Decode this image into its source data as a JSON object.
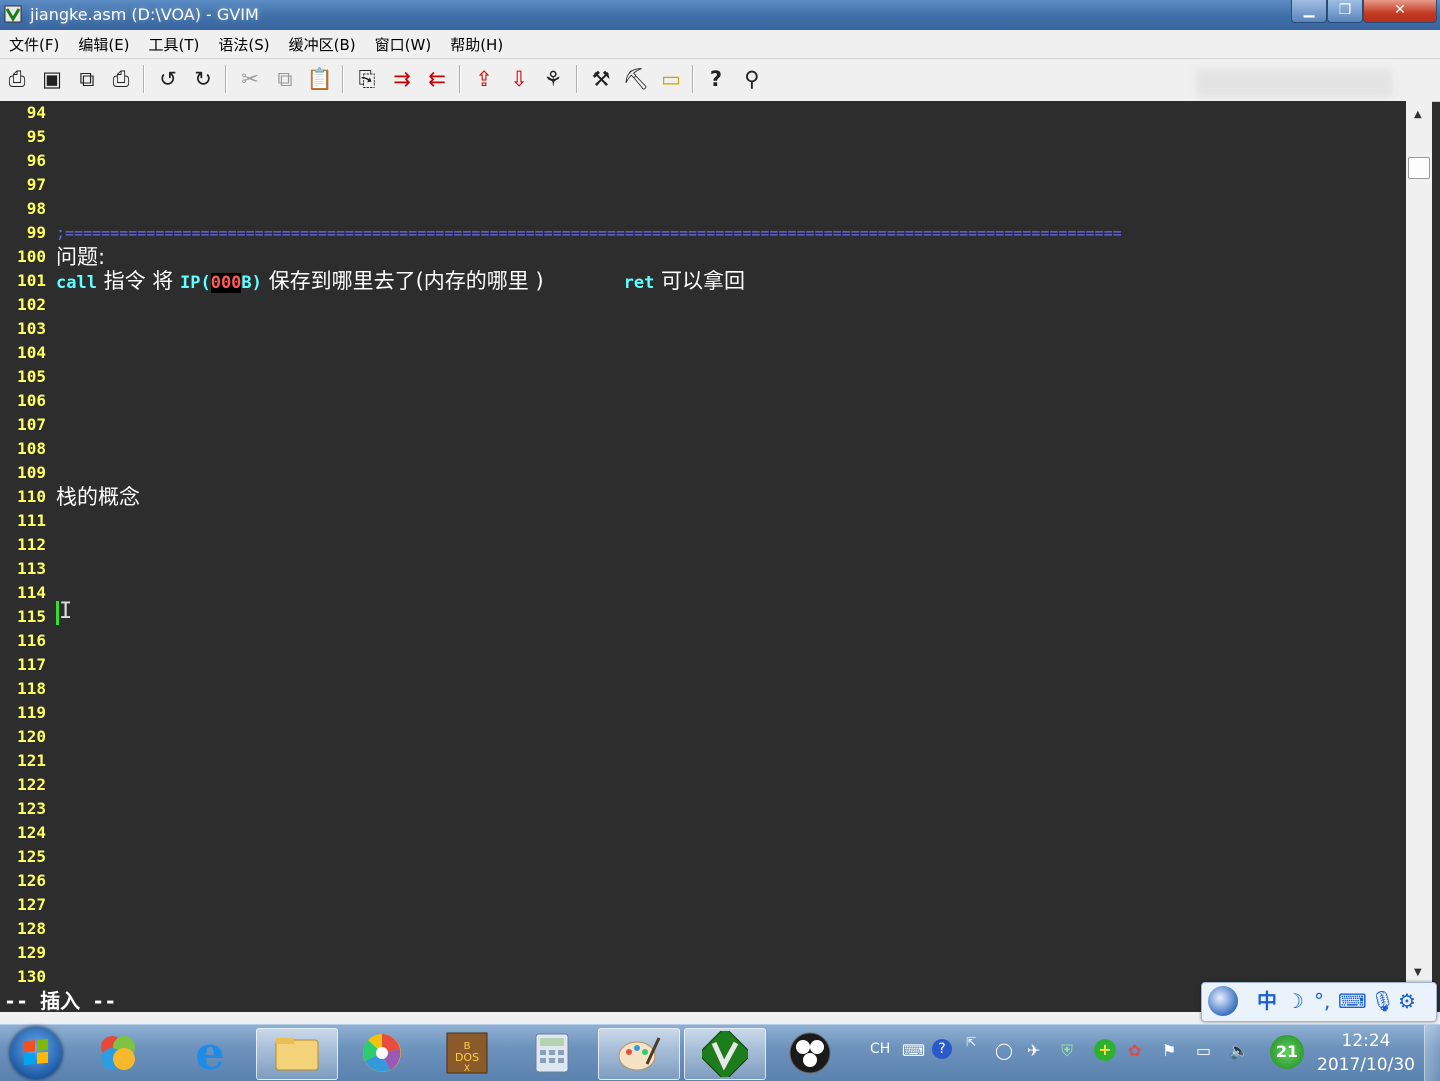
{
  "window": {
    "title": "jiangke.asm (D:\\VOA) - GVIM",
    "minimize": "▁",
    "maximize": "❐",
    "close": "✕"
  },
  "menu": [
    {
      "label": "文件(F)"
    },
    {
      "label": "编辑(E)"
    },
    {
      "label": "工具(T)"
    },
    {
      "label": "语法(S)"
    },
    {
      "label": "缓冲区(B)"
    },
    {
      "label": "窗口(W)"
    },
    {
      "label": "帮助(H)"
    }
  ],
  "toolbar": {
    "icons": [
      "open-file-icon",
      "save-icon",
      "save-all-icon",
      "print-icon",
      "undo-icon",
      "redo-icon",
      "cut-icon",
      "copy-icon",
      "paste-icon",
      "find-replace-icon",
      "find-next-icon",
      "find-prev-icon",
      "load-session-icon",
      "save-session-icon",
      "run-script-icon",
      "make-icon",
      "shell-icon",
      "ctags-icon",
      "help-icon",
      "find-help-icon"
    ]
  },
  "editor": {
    "line_numbers": [
      "94",
      "95",
      "96",
      "97",
      "98",
      "99",
      "100",
      "101",
      "102",
      "103",
      "104",
      "105",
      "106",
      "107",
      "108",
      "109",
      "110",
      "111",
      "112",
      "113",
      "114",
      "115",
      "116",
      "117",
      "118",
      "119",
      "120",
      "121",
      "122",
      "123",
      "124",
      "125",
      "126",
      "127",
      "128",
      "129",
      "130"
    ],
    "line99": ";=====================================================================================================================",
    "line100": "问题:",
    "line101": {
      "call": "call",
      "t1": " 指令 将 ",
      "ip": "IP(",
      "num": "000",
      "b": "B)",
      "t2": " 保存到哪里去了(内存的哪里 )",
      "ret": "ret",
      "t3": " 可以拿回"
    },
    "line110": "栈的概念",
    "colors": {
      "background": "#2d2d2d",
      "line_number": "#ffff60",
      "keyword": "#60ffff",
      "separator": "#6a6af0",
      "cursor": "#33dd33",
      "highlight": "#ff5a5a"
    }
  },
  "statusline": {
    "mode": "-- 插入 --"
  },
  "ime": {
    "mode_char": "中",
    "items": [
      "punct-icon",
      "moon-icon",
      "keyboard-icon",
      "mic-icon",
      "gear-icon"
    ]
  },
  "taskbar": {
    "apps": [
      "start-button",
      "windows-live-icon",
      "internet-explorer-icon",
      "file-explorer-icon",
      "picasa-icon",
      "dosbox-icon",
      "calculator-icon",
      "paint-icon",
      "gvim-icon",
      "obs-icon"
    ],
    "tray": {
      "lang": "CH",
      "badge": "21"
    },
    "clock": {
      "time": "12:24",
      "date": "2017/10/30"
    }
  }
}
